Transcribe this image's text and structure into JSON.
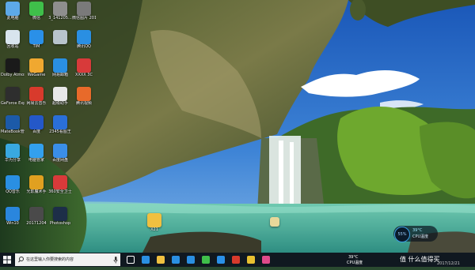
{
  "desktop": {
    "icons": [
      {
        "label": "此电脑",
        "color": "#5da9e8",
        "col": 0,
        "row": 0
      },
      {
        "label": "回收站",
        "color": "#d8e4ee",
        "col": 0,
        "row": 1
      },
      {
        "label": "Dolby Atmos",
        "color": "#1a1a1a",
        "col": 0,
        "row": 2
      },
      {
        "label": "GeForce Experience",
        "color": "#2e2e2e",
        "col": 0,
        "row": 3
      },
      {
        "label": "MateBook管家",
        "color": "#1c5aa8",
        "col": 0,
        "row": 4
      },
      {
        "label": "华为分享",
        "color": "#39a8e0",
        "col": 0,
        "row": 5
      },
      {
        "label": "QQ音乐",
        "color": "#2a8fe2",
        "col": 0,
        "row": 6
      },
      {
        "label": "Win10",
        "color": "#2a86dd",
        "col": 0,
        "row": 7
      },
      {
        "label": "微信",
        "color": "#3fbf4a",
        "col": 1,
        "row": 0
      },
      {
        "label": "TIM",
        "color": "#2a90e8",
        "col": 1,
        "row": 1
      },
      {
        "label": "WeGame",
        "color": "#f0a830",
        "col": 1,
        "row": 2
      },
      {
        "label": "网易云音乐",
        "color": "#d83a2c",
        "col": 1,
        "row": 3
      },
      {
        "label": "百度",
        "color": "#2458c8",
        "col": 1,
        "row": 4
      },
      {
        "label": "电脑管家",
        "color": "#33a0ee",
        "col": 1,
        "row": 5
      },
      {
        "label": "光影魔术手",
        "color": "#e0a020",
        "col": 1,
        "row": 6
      },
      {
        "label": "20171204",
        "color": "#4a4a4a",
        "col": 1,
        "row": 7
      },
      {
        "label": "3_141205...",
        "color": "#8e8e8e",
        "col": 2,
        "row": 0
      },
      {
        "label": "",
        "color": "#b8c4cc",
        "col": 2,
        "row": 1
      },
      {
        "label": "网易邮箱",
        "color": "#2a8fe2",
        "col": 2,
        "row": 2
      },
      {
        "label": "超级助手",
        "color": "#e8e8e8",
        "col": 2,
        "row": 3
      },
      {
        "label": "2345看图王",
        "color": "#2a6fd8",
        "col": 2,
        "row": 4
      },
      {
        "label": "百度网盘",
        "color": "#3a8ee8",
        "col": 2,
        "row": 5
      },
      {
        "label": "360安全卫士",
        "color": "#d83a3a",
        "col": 2,
        "row": 6
      },
      {
        "label": "Photoshop",
        "color": "#1d2e48",
        "col": 2,
        "row": 7
      },
      {
        "label": "微信图片 20171221",
        "color": "#7a7a7a",
        "col": 3,
        "row": 0
      },
      {
        "label": "腾讯QQ",
        "color": "#2a8fe2",
        "col": 3,
        "row": 1
      },
      {
        "label": "XXXX 3C",
        "color": "#d83a3a",
        "col": 3,
        "row": 2
      },
      {
        "label": "腾讯视频",
        "color": "#e86a2a",
        "col": 3,
        "row": 3
      }
    ],
    "folder_label": "X21"
  },
  "widget": {
    "cpu_pct": "55%",
    "cpu_temp": "39°C",
    "cpu_label": "CPU温度"
  },
  "taskbar": {
    "search_placeholder": "在这里输入你要搜索的内容",
    "cpu_temp": "39°C",
    "cpu_label": "CPU温度",
    "watermark": "值 什么值得买",
    "date": "2017/12/21",
    "app_icons": [
      {
        "name": "task-view-icon",
        "color": "#ffffff"
      },
      {
        "name": "edge-icon",
        "color": "#2a8fe2"
      },
      {
        "name": "file-explorer-icon",
        "color": "#f0c040"
      },
      {
        "name": "store-icon",
        "color": "#2a8fe2"
      },
      {
        "name": "qq-icon",
        "color": "#2a8fe2"
      },
      {
        "name": "wechat-icon",
        "color": "#3fbf4a"
      },
      {
        "name": "mail-icon",
        "color": "#2a90e8"
      },
      {
        "name": "netease-music-icon",
        "color": "#d83a2c"
      },
      {
        "name": "chrome-icon",
        "color": "#e8c030"
      },
      {
        "name": "paint-icon",
        "color": "#e04a8a"
      }
    ]
  }
}
